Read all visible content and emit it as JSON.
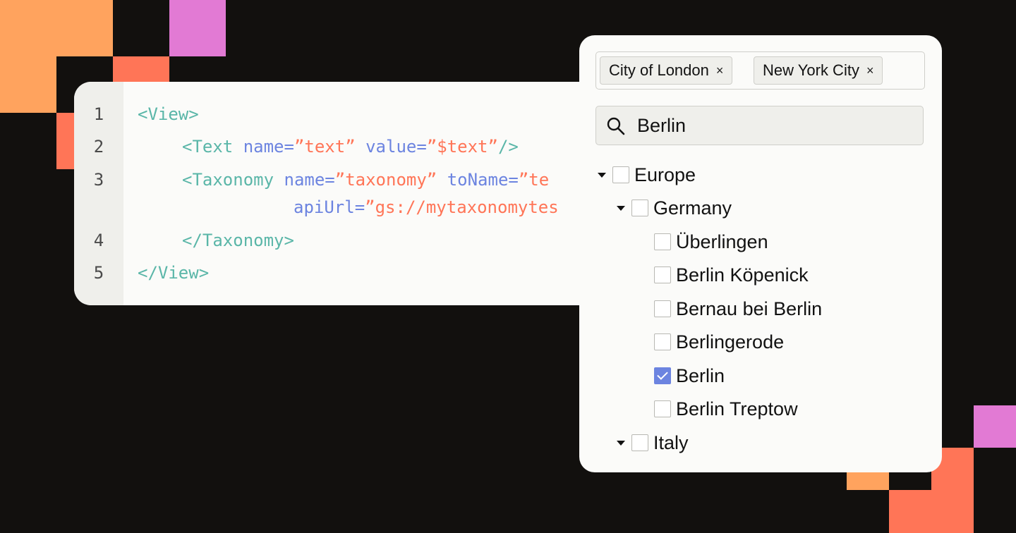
{
  "colors": {
    "background": "#12100e",
    "orange": "#ffa35e",
    "coral": "#ff7557",
    "pink": "#e27ad4",
    "tag": "#5ab6a8",
    "attribute": "#6c84e0",
    "string": "#ff7557",
    "checkbox_checked": "#6c84e0"
  },
  "code": {
    "line_numbers": [
      "1",
      "2",
      "3",
      "4",
      "5"
    ],
    "line1": {
      "tag": "<View>"
    },
    "line2": {
      "tag_open": "<Text",
      "attr1": "name=",
      "val1": "”text”",
      "attr2": "value=",
      "val2": "”$text”",
      "tag_close": "/>"
    },
    "line3": {
      "tag_open": "<Taxonomy",
      "attr1": "name=",
      "val1": "”taxonomy”",
      "attr2": "toName=",
      "val2": "”te",
      "attr3": "apiUrl=",
      "val3": "”gs://mytaxonomytes"
    },
    "line4": {
      "tag": "</Taxonomy>"
    },
    "line5": {
      "tag": "</View>"
    }
  },
  "taxonomy": {
    "selected_chips": [
      {
        "label": "City of London",
        "remove": "×"
      },
      {
        "label": "New York City",
        "remove": "×"
      }
    ],
    "search": {
      "value": "Berlin",
      "icon": "search-icon"
    },
    "tree": {
      "europe": "Europe",
      "germany": "Germany",
      "cities": [
        {
          "label": "Überlingen",
          "checked": false
        },
        {
          "label": "Berlin Köpenick",
          "checked": false
        },
        {
          "label": "Bernau bei Berlin",
          "checked": false
        },
        {
          "label": "Berlingerode",
          "checked": false
        },
        {
          "label": "Berlin",
          "checked": true
        },
        {
          "label": "Berlin Treptow",
          "checked": false
        }
      ],
      "italy": "Italy"
    }
  }
}
